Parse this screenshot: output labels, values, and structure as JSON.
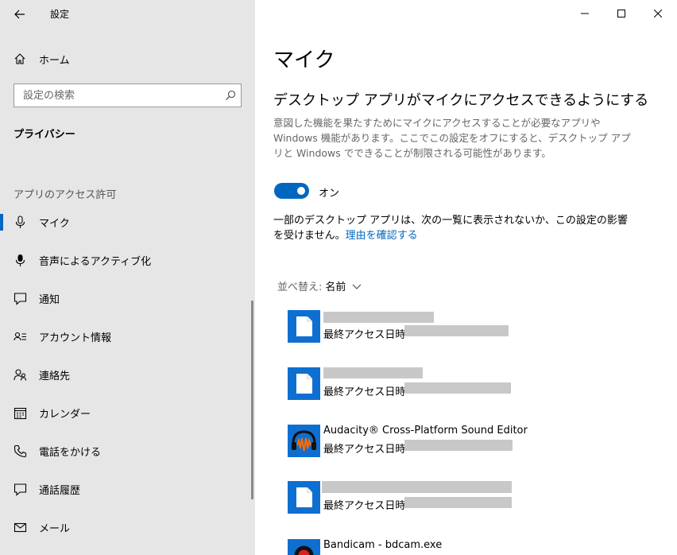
{
  "window": {
    "title": "設定",
    "controls": {
      "minimize": "minimize-icon",
      "maximize": "maximize-icon",
      "close": "close-icon"
    }
  },
  "sidebar": {
    "home_label": "ホーム",
    "search_placeholder": "設定の検索",
    "section_title": "プライバシー",
    "group_label": "アプリのアクセス許可",
    "items": [
      {
        "label": "マイク",
        "icon": "microphone-icon",
        "active": true
      },
      {
        "label": "音声によるアクティブ化",
        "icon": "microphone-icon",
        "active": false
      },
      {
        "label": "通知",
        "icon": "notification-icon",
        "active": false
      },
      {
        "label": "アカウント情報",
        "icon": "account-info-icon",
        "active": false
      },
      {
        "label": "連絡先",
        "icon": "contacts-icon",
        "active": false
      },
      {
        "label": "カレンダー",
        "icon": "calendar-icon",
        "active": false
      },
      {
        "label": "電話をかける",
        "icon": "phone-icon",
        "active": false
      },
      {
        "label": "通話履歴",
        "icon": "call-history-icon",
        "active": false
      },
      {
        "label": "メール",
        "icon": "mail-icon",
        "active": false
      }
    ]
  },
  "main": {
    "title": "マイク",
    "subtitle": "デスクトップ アプリがマイクにアクセスできるようにする",
    "description": "意図した機能を果たすためにマイクにアクセスすることが必要なアプリや Windows 機能があります。ここでこの設定をオフにすると、デスクトップ アプリと Windows でできることが制限される可能性があります。",
    "toggle": {
      "state": "on",
      "label": "オン"
    },
    "note": "一部のデスクトップ アプリは、次の一覧に表示されないか、この設定の影響を受けません。",
    "note_link": "理由を確認する",
    "sort_label": "並べ替え:",
    "sort_value": "名前",
    "apps": [
      {
        "name": "",
        "last_access": "最終アクセス日時",
        "icon": "file-icon",
        "name_redacted": true
      },
      {
        "name": "",
        "last_access": "最終アクセス日時",
        "icon": "file-icon",
        "name_redacted": true
      },
      {
        "name": "Audacity® Cross-Platform Sound Editor",
        "last_access": "最終アクセス日時",
        "icon": "audacity-icon",
        "name_redacted": false
      },
      {
        "name": "",
        "last_access": "最終アクセス日時",
        "icon": "file-icon",
        "name_redacted": true
      },
      {
        "name": "Bandicam - bdcam.exe",
        "last_access": "",
        "icon": "bandicam-icon",
        "name_redacted": false
      }
    ]
  },
  "colors": {
    "accent": "#0067c0",
    "sidebar_bg": "#e6e6e6",
    "app_tile": "#0f6fd1",
    "redaction": "#c8c8c8"
  }
}
